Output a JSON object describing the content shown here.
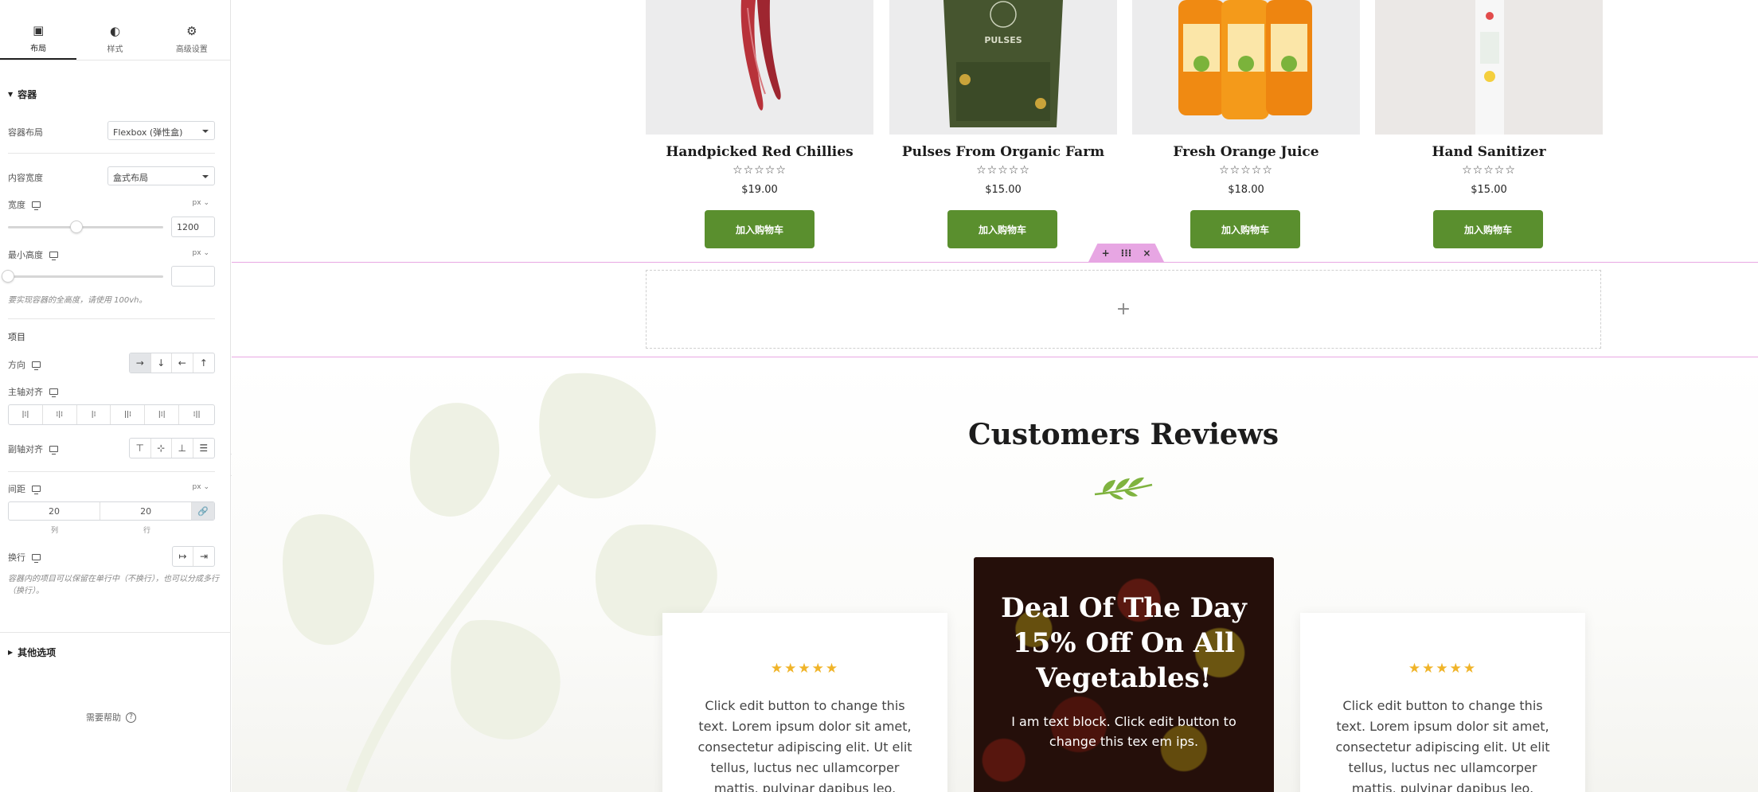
{
  "panel": {
    "tabs": [
      {
        "label": "布局",
        "icon": "layout-icon"
      },
      {
        "label": "样式",
        "icon": "contrast-icon"
      },
      {
        "label": "高级设置",
        "icon": "gear-icon"
      }
    ],
    "container_section": "容器",
    "container_layout": {
      "label": "容器布局",
      "value": "Flexbox (弹性盒)"
    },
    "content_width": {
      "label": "内容宽度",
      "value": "盒式布局"
    },
    "width": {
      "label": "宽度",
      "unit": "px",
      "value": "1200",
      "slider_fraction": 0.44
    },
    "min_height": {
      "label": "最小高度",
      "unit": "px",
      "value": "",
      "slider_fraction": 0.0,
      "hint": "要实现容器的全高度，请使用 100vh。"
    },
    "items_section": "项目",
    "direction": {
      "label": "方向",
      "options": [
        "→",
        "↓",
        "←",
        "↑"
      ],
      "selected": 0
    },
    "justify": {
      "label": "主轴对齐",
      "options": [
        "|⁞|",
        "⁞|⁞",
        "|⁞",
        "||⁞",
        "|⁞|",
        "⁞||"
      ]
    },
    "align": {
      "label": "副轴对齐",
      "options": [
        "⊤",
        "⊹",
        "⊥",
        "☰"
      ]
    },
    "gap": {
      "label": "间距",
      "unit": "px",
      "column": "20",
      "row": "20",
      "column_label": "列",
      "row_label": "行"
    },
    "wrap": {
      "label": "换行",
      "options": [
        "↦",
        "⇥"
      ],
      "hint": "容器内的项目可以保留在单行中（不换行），也可以分成多行（换行）。"
    },
    "other_section": "其他选项",
    "help": "需要帮助"
  },
  "products": [
    {
      "title": "Handpicked Red Chillies",
      "price": "$19.00",
      "button": "加入购物车",
      "rating": "☆☆☆☆☆"
    },
    {
      "title": "Pulses From Organic Farm",
      "price": "$15.00",
      "button": "加入购物车",
      "rating": "☆☆☆☆☆",
      "pack_label": "PULSES"
    },
    {
      "title": "Fresh Orange Juice",
      "price": "$18.00",
      "button": "加入购物车",
      "rating": "☆☆☆☆☆"
    },
    {
      "title": "Hand Sanitizer",
      "price": "$15.00",
      "button": "加入购物车",
      "rating": "☆☆☆☆☆"
    }
  ],
  "section_handle": {
    "add": "+",
    "move": "⁝⁝⁝",
    "close": "×"
  },
  "drop_zone_icon": "+",
  "reviews": {
    "heading": "Customers Reviews",
    "left_card": {
      "stars": "★★★★★",
      "text": "Click edit button to change this text. Lorem ipsum dolor sit amet, consectetur adipiscing elit. Ut elit tellus, luctus nec ullamcorper mattis, pulvinar dapibus leo."
    },
    "deal": {
      "title": "Deal Of The Day 15% Off On All Vegetables!",
      "text": "I am text block. Click edit button to change this tex em ips."
    },
    "right_card": {
      "stars": "★★★★★",
      "text": "Click edit button to change this text. Lorem ipsum dolor sit amet, consectetur adipiscing elit. Ut elit tellus, luctus nec ullamcorper mattis, pulvinar dapibus leo."
    }
  },
  "colors": {
    "accent_green": "#5a8f2e",
    "selection_pink": "#e7a6e3",
    "star_gold": "#f0b429"
  }
}
